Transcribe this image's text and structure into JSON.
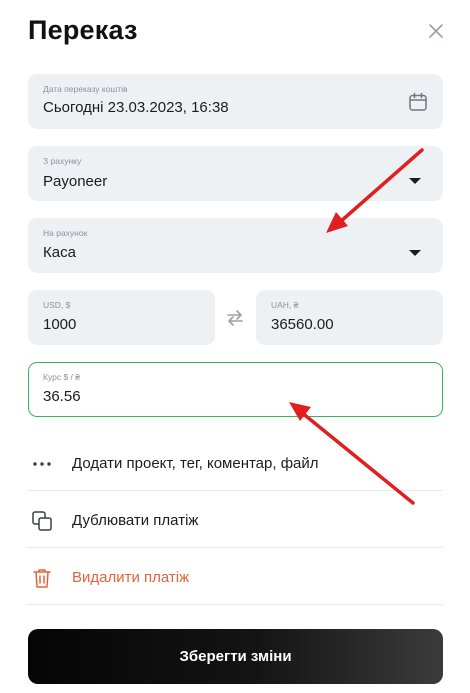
{
  "header": {
    "title": "Переказ"
  },
  "date_field": {
    "label": "Дата переказу коштів",
    "value": "Сьогодні 23.03.2023, 16:38"
  },
  "from_account": {
    "label": "З рахунку",
    "value": "Payoneer"
  },
  "to_account": {
    "label": "На рахунок",
    "value": "Каса"
  },
  "amount_from": {
    "label": "USD, $",
    "value": "1000"
  },
  "amount_to": {
    "label": "UAH, ₴",
    "value": "36560.00"
  },
  "rate": {
    "label": "Курс  $  /  ₴",
    "value": "36.56"
  },
  "actions": [
    {
      "label": "Додати проект, тег, коментар, файл",
      "icon": "more-dots-icon"
    },
    {
      "label": "Дублювати платіж",
      "icon": "duplicate-icon"
    },
    {
      "label": "Видалити платіж",
      "icon": "trash-icon"
    }
  ],
  "save_button": {
    "label": "Зберегти зміни"
  },
  "colors": {
    "field_bg": "#edf1f4",
    "rate_border": "#3bb15e",
    "delete": "#e8613c",
    "annotation_arrow": "#e02020"
  }
}
